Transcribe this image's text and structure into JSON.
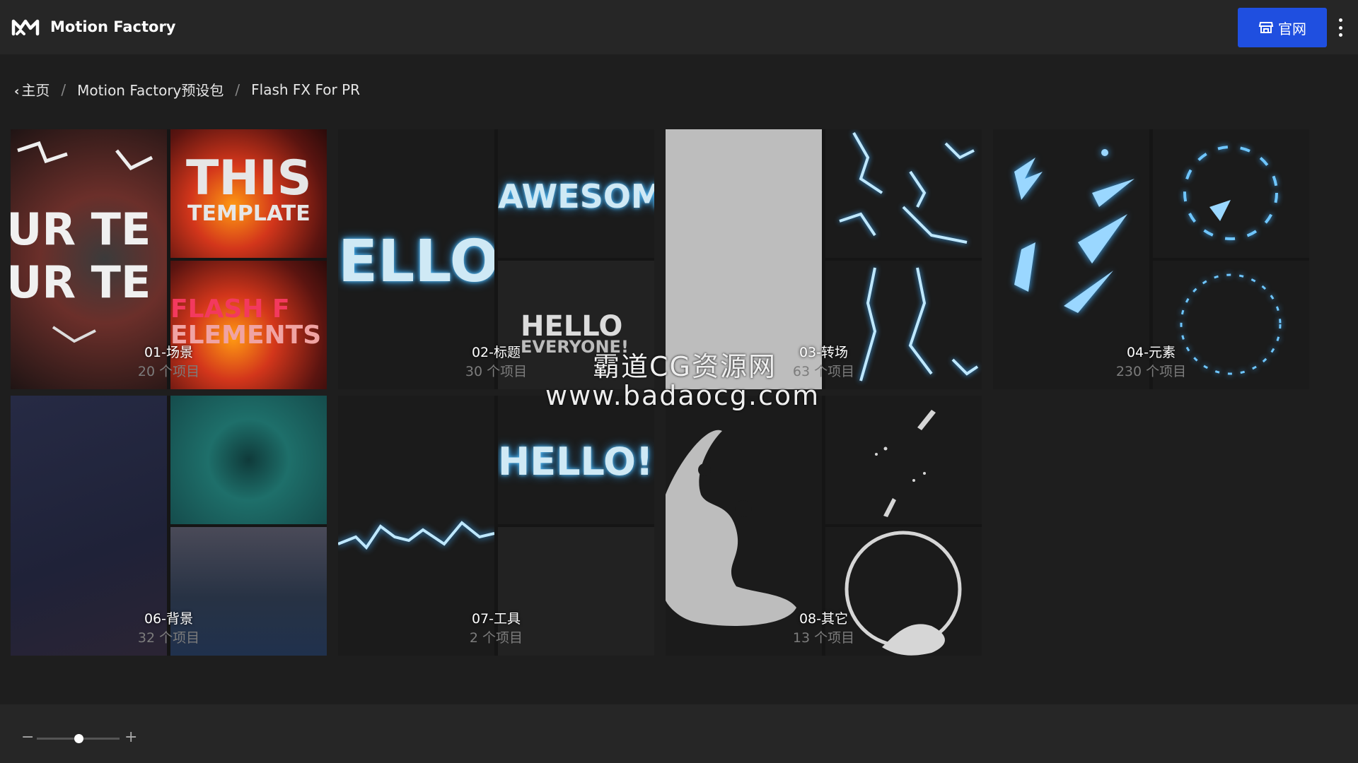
{
  "header": {
    "app_title": "Motion Factory",
    "site_button_label": "官网"
  },
  "breadcrumb": {
    "items": [
      {
        "label": "主页"
      },
      {
        "label": "Motion Factory预设包"
      },
      {
        "label": "Flash FX For PR"
      }
    ],
    "separator": "/"
  },
  "cards": [
    {
      "name": "01-场景",
      "count": "20 个项目",
      "thumb_text": {
        "tr_line1": "THIS",
        "tr_line2": "TEMPLATE",
        "br_line1": "FLASH F",
        "br_line2": "ELEMENTS",
        "left_line": "UR TE"
      }
    },
    {
      "name": "02-标题",
      "count": "30 个项目",
      "thumb_text": {
        "left": "ELLO",
        "tr": "AWESOME",
        "br_line1": "HELLO",
        "br_line2": "EVERYONE!"
      }
    },
    {
      "name": "03-转场",
      "count": "63 个项目"
    },
    {
      "name": "04-元素",
      "count": "230 个项目"
    },
    {
      "name": "06-背景",
      "count": "32 个项目"
    },
    {
      "name": "07-工具",
      "count": "2 个项目",
      "thumb_text": {
        "tr": "HELLO!"
      }
    },
    {
      "name": "08-其它",
      "count": "13 个项目"
    }
  ],
  "watermark": {
    "line1": "霸道CG资源网",
    "line2": "www.badaocg.com"
  },
  "zoom": {
    "minus": "−",
    "plus": "+",
    "level": 0.5
  },
  "colors": {
    "accent": "#1f4fe0",
    "background": "#1e1e1e",
    "header": "#262626",
    "glow": "#5cc4ff"
  }
}
